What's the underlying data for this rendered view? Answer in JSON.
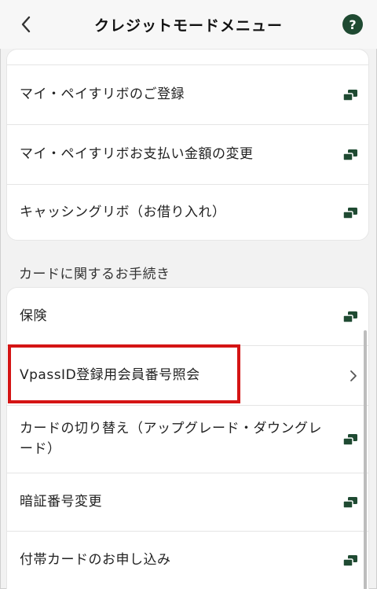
{
  "header": {
    "title": "クレジットモードメニュー",
    "back_icon": "chevron-left-icon",
    "help_label": "?"
  },
  "group1": {
    "items": [
      {
        "label": "マイ・ペイすリボのご登録",
        "icon": "external-link-icon"
      },
      {
        "label": "マイ・ペイすリボお支払い金額の変更",
        "icon": "external-link-icon"
      },
      {
        "label": "キャッシングリボ（お借り入れ）",
        "icon": "external-link-icon"
      }
    ]
  },
  "section2": {
    "title": "カードに関するお手続き",
    "items": [
      {
        "label": "保険",
        "icon": "external-link-icon"
      },
      {
        "label": "VpassID登録用会員番号照会",
        "icon": "chevron-right-icon"
      },
      {
        "label": "カードの切り替え（アップグレード・ダウングレード）",
        "icon": "external-link-icon"
      },
      {
        "label": "暗証番号変更",
        "icon": "external-link-icon"
      },
      {
        "label": "付帯カードのお申し込み",
        "icon": "external-link-icon"
      }
    ]
  },
  "colors": {
    "accent": "#1f4a32",
    "highlight": "#d41414"
  }
}
